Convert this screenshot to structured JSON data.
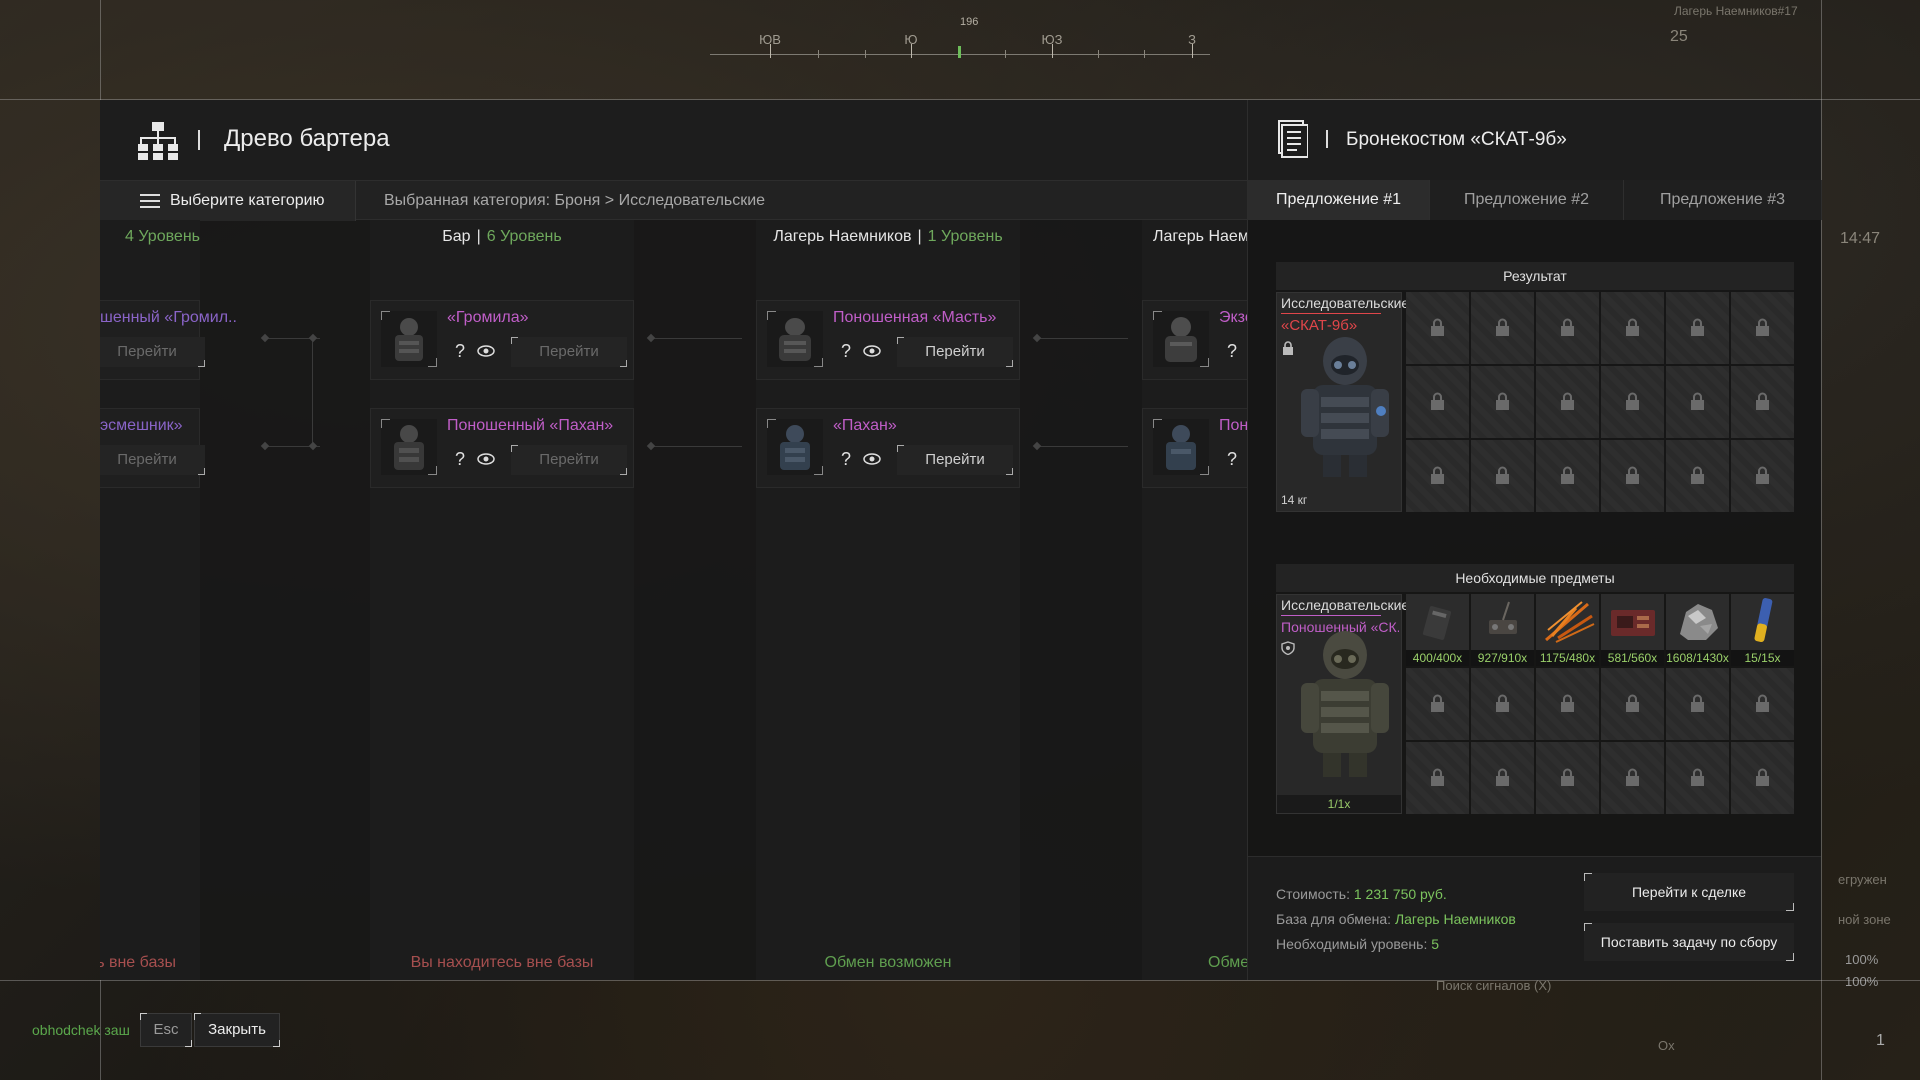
{
  "hud": {
    "compass_labels": [
      "ЮВ",
      "Ю",
      "ЮЗ",
      "З"
    ],
    "compass_degrees": "196",
    "top_right_label": "Лагерь Наемников#17",
    "top_right_number": "25",
    "clock": "14:47",
    "side_text_1": "егружен",
    "side_text_2": "ной зоне",
    "percent_1": "100%",
    "percent_2": "100%",
    "signal_search": "Поиск сигналов (X)",
    "bottom_ox": "Ox",
    "bottom_num": "1"
  },
  "barter": {
    "title": "Древо бартера",
    "category_button": "Выберите категорию",
    "breadcrumb": "Выбранная категория: Броня > Исследовательские",
    "columns": [
      {
        "location": "",
        "level": "4 Уровень",
        "footer": "тесь вне базы",
        "nodes": [
          {
            "name": "шенный «Громил..",
            "action": "Перейти"
          },
          {
            "name": "эсмешник»",
            "action": "Перейти"
          }
        ]
      },
      {
        "location": "Бар",
        "level": "6 Уровень",
        "footer": "Вы находитесь вне базы",
        "nodes": [
          {
            "name": "«Громила»",
            "q": "?",
            "action": "Перейти"
          },
          {
            "name": "Поношенный «Пахан»",
            "q": "?",
            "action": "Перейти"
          }
        ]
      },
      {
        "location": "Лагерь Наемников",
        "level": "1 Уровень",
        "footer": "Обмен возможен",
        "nodes": [
          {
            "name": "Поношенная «Масть»",
            "q": "?",
            "action": "Перейти"
          },
          {
            "name": "«Пахан»",
            "q": "?",
            "action": "Перейти"
          }
        ]
      },
      {
        "location": "Лагерь Наем",
        "level": "",
        "footer": "Обме",
        "nodes": [
          {
            "name": "Экзо",
            "q": "?"
          },
          {
            "name": "Пон",
            "q": "?"
          }
        ]
      }
    ]
  },
  "offer": {
    "title": "Бронекостюм «СКАТ-9б»",
    "tabs": [
      "Предложение #1",
      "Предложение #2",
      "Предложение #3"
    ],
    "result_title": "Результат",
    "result_item": {
      "category": "Исследовательские",
      "name": "«СКАТ-9б»",
      "weight": "14 кг"
    },
    "required_title": "Необходимые предметы",
    "required_item": {
      "category": "Исследовательские",
      "name": "Поношенный «СК..",
      "qty": "1/1x"
    },
    "required_counts": [
      "400/400x",
      "927/910x",
      "1175/480x",
      "581/560x",
      "1608/1430x",
      "15/15x"
    ],
    "cost_label": "Стоимость:",
    "cost_value": "1 231 750 руб.",
    "base_label": "База для обмена:",
    "base_value": "Лагерь Наемников",
    "level_label": "Необходимый уровень:",
    "level_value": "5",
    "goto_deal": "Перейти к сделке",
    "set_task": "Поставить задачу по сбору",
    "colors": {
      "accent_green": "#7cc45e",
      "item_purple": "#c05ec8",
      "item_red": "#e0464a"
    }
  },
  "bottom": {
    "status": "obhodchek заш",
    "esc_key": "Esc",
    "close": "Закрыть"
  }
}
